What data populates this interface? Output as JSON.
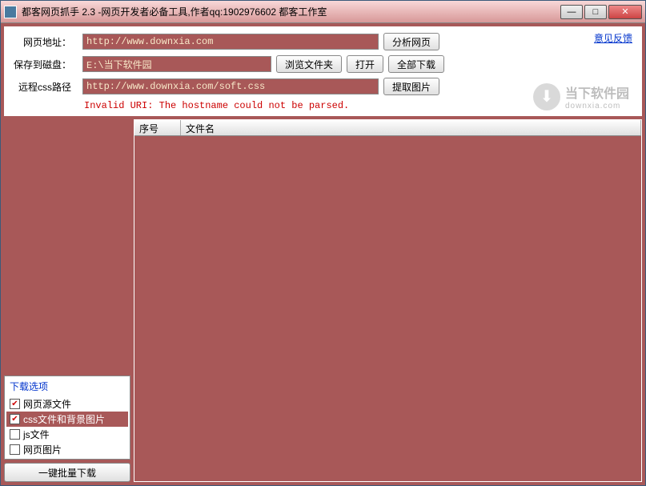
{
  "titlebar": {
    "text": "都客网页抓手 2.3 -网页开发者必备工具,作者qq:1902976602 都客工作室"
  },
  "feedback": "意见反馈",
  "labels": {
    "url": "网页地址：",
    "save": "保存到磁盘：",
    "css": "远程css路径"
  },
  "inputs": {
    "url": "http://www.downxia.com",
    "save": "E:\\当下软件园",
    "css": "http://www.downxia.com/soft.css"
  },
  "buttons": {
    "analyze": "分析网页",
    "browse": "浏览文件夹",
    "open": "打开",
    "downloadAll": "全部下载",
    "extractImg": "提取图片",
    "batchDownload": "一键批量下载"
  },
  "error": "Invalid URI: The hostname could not be parsed.",
  "watermark": {
    "main": "当下软件园",
    "sub": "downxia.com"
  },
  "options": {
    "title": "下载选项",
    "items": [
      {
        "label": "网页源文件",
        "checked": true,
        "selected": false
      },
      {
        "label": "css文件和背景图片",
        "checked": true,
        "selected": true
      },
      {
        "label": "js文件",
        "checked": false,
        "selected": false
      },
      {
        "label": "网页图片",
        "checked": false,
        "selected": false
      }
    ]
  },
  "listHeader": {
    "col1": "序号",
    "col2": "文件名"
  }
}
